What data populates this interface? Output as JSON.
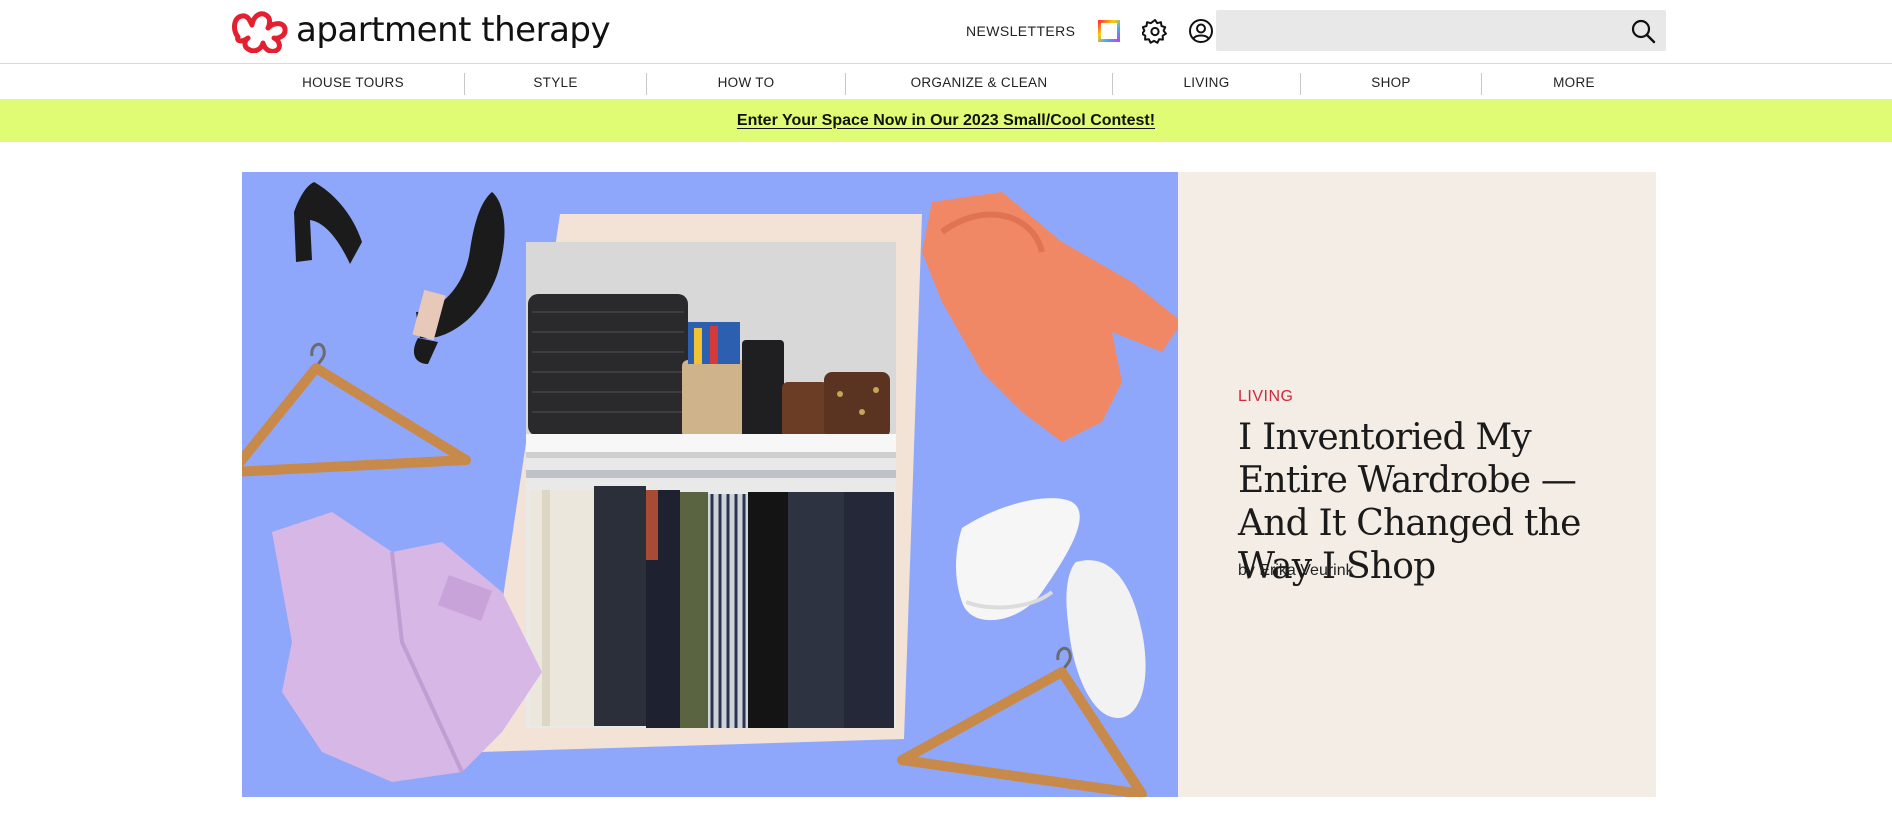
{
  "brand": {
    "name": "apartment therapy",
    "logo_color": "#e3202f"
  },
  "header": {
    "newsletters_label": "NEWSLETTERS",
    "search": {
      "placeholder": "",
      "value": ""
    },
    "icons": [
      "color-square-icon",
      "settings-gear-icon",
      "account-icon",
      "search-icon"
    ]
  },
  "nav": {
    "items": [
      {
        "label": "HOUSE TOURS"
      },
      {
        "label": "STYLE"
      },
      {
        "label": "HOW TO"
      },
      {
        "label": "ORGANIZE & CLEAN"
      },
      {
        "label": "LIVING"
      },
      {
        "label": "SHOP"
      },
      {
        "label": "MORE"
      }
    ]
  },
  "banner": {
    "text": "Enter Your Space Now in Our 2023 Small/Cool Contest!",
    "background": "#dffc74"
  },
  "hero": {
    "category": "LIVING",
    "category_color": "#d2283c",
    "headline": "I Inventoried My Entire Wardrobe — And It Changed the Way I Shop",
    "byline_prefix": "by",
    "author": "Erika Veurink",
    "image_background": "#8fa7fb",
    "panel_background": "#f3ede6"
  }
}
